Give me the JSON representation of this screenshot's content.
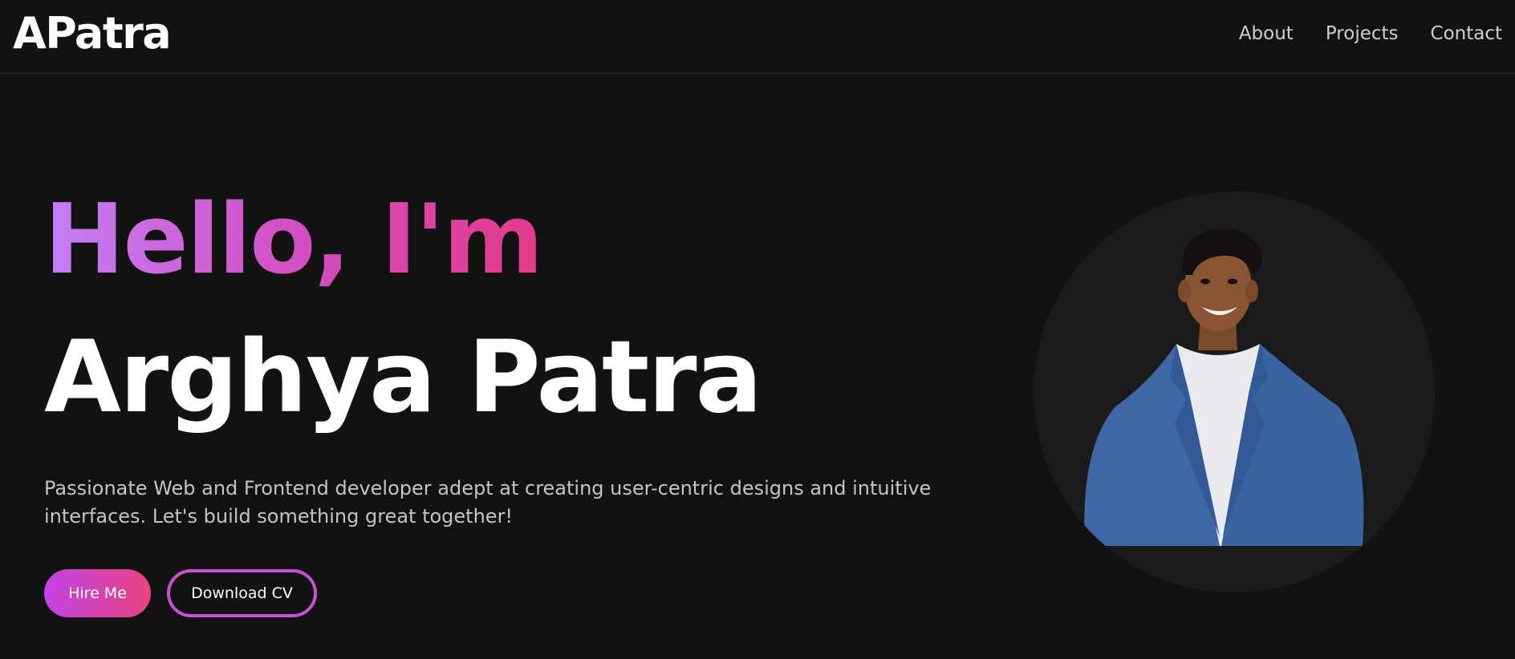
{
  "brand": {
    "logo_text": "APatra"
  },
  "nav": {
    "items": [
      {
        "label": "About"
      },
      {
        "label": "Projects"
      },
      {
        "label": "Contact"
      }
    ]
  },
  "hero": {
    "greeting": "Hello, I'm",
    "name": "Arghya Patra",
    "tagline": "Passionate Web and Frontend developer adept at creating user-centric designs and intuitive interfaces. Let's build something great together!",
    "primary_button": "Hire Me",
    "secondary_button": "Download CV"
  },
  "colors": {
    "background": "#121212",
    "accent_start": "#c57ef7",
    "accent_end": "#e43b88",
    "avatar_circle": "#1b1b1b"
  },
  "avatar": {
    "icon": "profile-photo"
  }
}
